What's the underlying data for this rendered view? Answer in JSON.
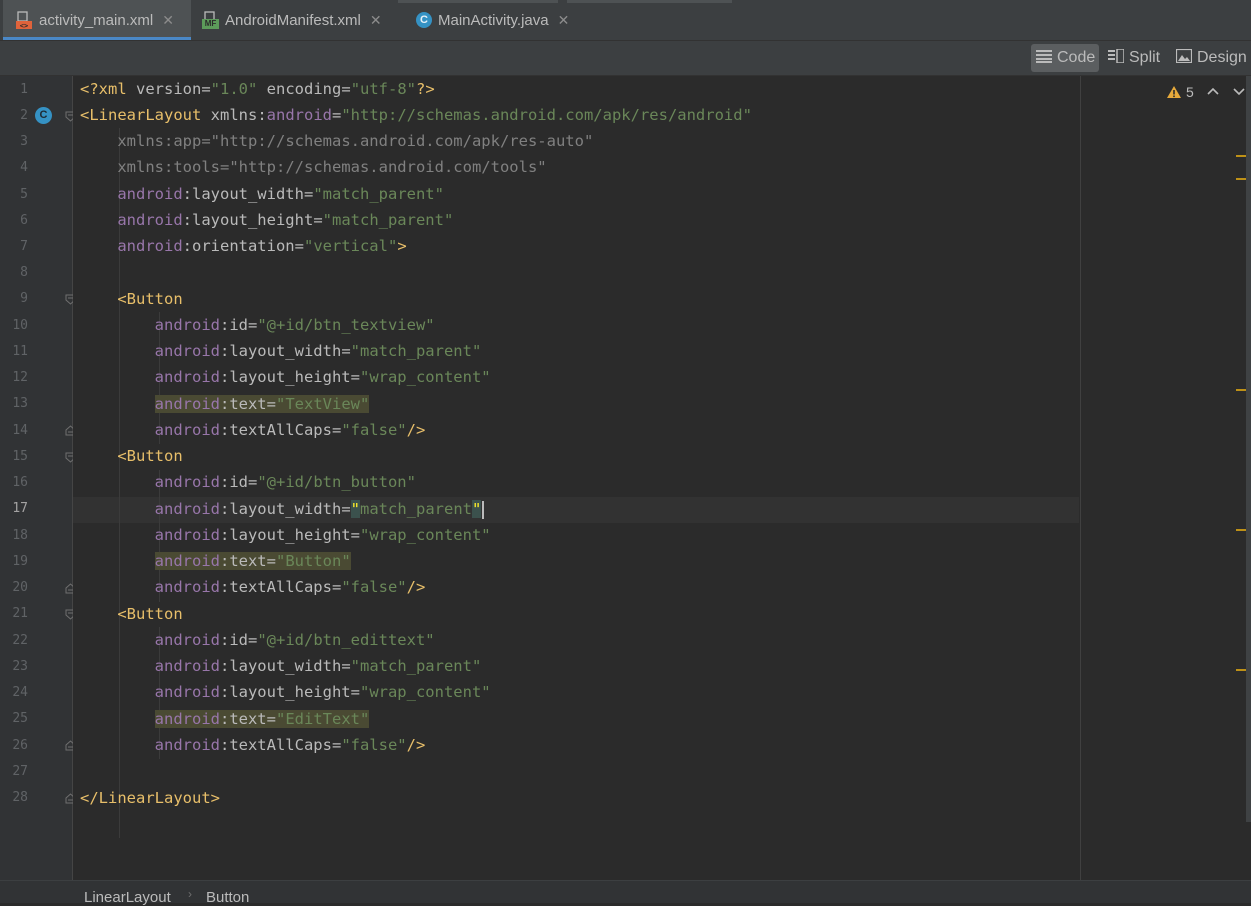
{
  "tabs": [
    {
      "label": "activity_main.xml",
      "icon": "xml-layout-icon",
      "active": true
    },
    {
      "label": "AndroidManifest.xml",
      "icon": "manifest-icon",
      "active": false
    },
    {
      "label": "MainActivity.java",
      "icon": "java-class-icon",
      "active": false
    }
  ],
  "view_modes": [
    {
      "label": "Code",
      "icon": "code-icon",
      "active": true
    },
    {
      "label": "Split",
      "icon": "split-icon",
      "active": false
    },
    {
      "label": "Design",
      "icon": "design-icon",
      "active": false
    }
  ],
  "inspections": {
    "warning_count": "5",
    "icon": "warning-icon"
  },
  "gutter": {
    "current_line": 17,
    "line_numbers": [
      "1",
      "2",
      "3",
      "4",
      "5",
      "6",
      "7",
      "8",
      "9",
      "10",
      "11",
      "12",
      "13",
      "14",
      "15",
      "16",
      "17",
      "18",
      "19",
      "20",
      "21",
      "22",
      "23",
      "24",
      "25",
      "26",
      "27",
      "28"
    ],
    "class_marker": "C"
  },
  "code": {
    "line1": {
      "open": "<?",
      "tag": "xml",
      "attr1": " version",
      "eq1": "=",
      "val1": "\"1.0\"",
      "attr2": " encoding",
      "eq2": "=",
      "val2": "\"utf-8\"",
      "close": "?>"
    },
    "line2": {
      "open": "<LinearLayout",
      "attr_pre": " xmlns:",
      "attr_ns": "android",
      "eq": "=",
      "val": "\"http://schemas.android.com/apk/res/android\""
    },
    "line3": {
      "attr": "xmlns:app",
      "eq": "=",
      "val": "\"http://schemas.android.com/apk/res-auto\""
    },
    "line4": {
      "attr": "xmlns:tools",
      "eq": "=",
      "val": "\"http://schemas.android.com/tools\""
    },
    "line5": {
      "ns": "android",
      "attr": ":layout_width",
      "eq": "=",
      "val": "\"match_parent\""
    },
    "line6": {
      "ns": "android",
      "attr": ":layout_height",
      "eq": "=",
      "val": "\"match_parent\""
    },
    "line7": {
      "ns": "android",
      "attr": ":orientation",
      "eq": "=",
      "val": "\"vertical\"",
      "close": ">"
    },
    "button_tag": "<Button",
    "line10": {
      "ns": "android",
      "attr": ":id",
      "eq": "=",
      "val": "\"@+id/btn_textview\""
    },
    "line11": {
      "ns": "android",
      "attr": ":layout_width",
      "eq": "=",
      "val": "\"match_parent\""
    },
    "line12": {
      "ns": "android",
      "attr": ":layout_height",
      "eq": "=",
      "val": "\"wrap_content\""
    },
    "line13": {
      "ns": "android",
      "attr": ":text",
      "eq": "=",
      "val": "\"TextView\""
    },
    "line14": {
      "ns": "android",
      "attr": ":textAllCaps",
      "eq": "=",
      "val": "\"false\"",
      "close": "/>"
    },
    "line16": {
      "ns": "android",
      "attr": ":id",
      "eq": "=",
      "val": "\"@+id/btn_button\""
    },
    "line17": {
      "ns": "android",
      "attr": ":layout_width",
      "eq": "=",
      "q1": "\"",
      "val": "match_parent",
      "q2": "\""
    },
    "line18": {
      "ns": "android",
      "attr": ":layout_height",
      "eq": "=",
      "val": "\"wrap_content\""
    },
    "line19": {
      "ns": "android",
      "attr": ":text",
      "eq": "=",
      "val": "\"Button\""
    },
    "line20": {
      "ns": "android",
      "attr": ":textAllCaps",
      "eq": "=",
      "val": "\"false\"",
      "close": "/>"
    },
    "line22": {
      "ns": "android",
      "attr": ":id",
      "eq": "=",
      "val": "\"@+id/btn_edittext\""
    },
    "line23": {
      "ns": "android",
      "attr": ":layout_width",
      "eq": "=",
      "val": "\"match_parent\""
    },
    "line24": {
      "ns": "android",
      "attr": ":layout_height",
      "eq": "=",
      "val": "\"wrap_content\""
    },
    "line25": {
      "ns": "android",
      "attr": ":text",
      "eq": "=",
      "val": "\"EditText\""
    },
    "line26": {
      "ns": "android",
      "attr": ":textAllCaps",
      "eq": "=",
      "val": "\"false\"",
      "close": "/>"
    },
    "line28": {
      "close_tag": "</LinearLayout>"
    }
  },
  "breadcrumb": [
    "LinearLayout",
    "Button"
  ],
  "colors": {
    "tag": "#e8bf6a",
    "namespace": "#9876aa",
    "string": "#6a8759",
    "attribute": "#bababa",
    "background": "#2b2b2b",
    "accent": "#4a88c7",
    "warning": "#be9117"
  }
}
